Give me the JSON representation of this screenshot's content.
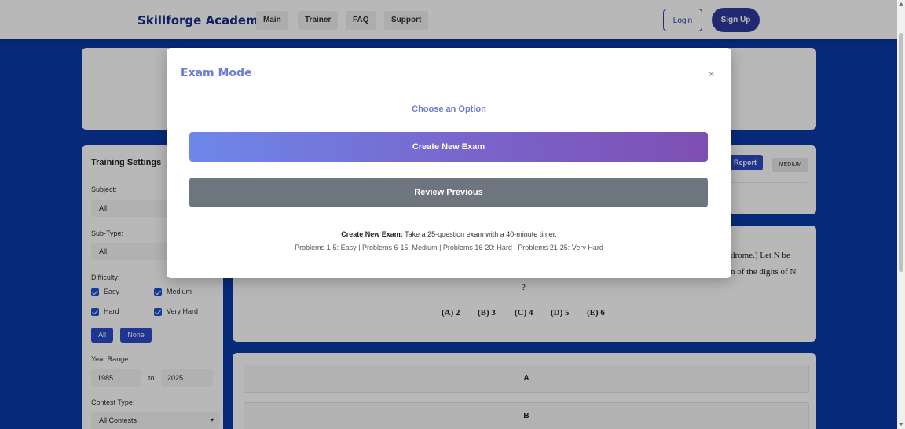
{
  "navbar": {
    "brand": "Skillforge Academy",
    "links": [
      "Main",
      "Trainer",
      "FAQ",
      "Support"
    ],
    "login_label": "Login",
    "signup_label": "Sign Up"
  },
  "sidebar": {
    "title": "Training Settings",
    "subject_label": "Subject:",
    "subject_value": "All",
    "subtype_label": "Sub-Type:",
    "subtype_value": "All",
    "difficulty_label": "Difficulty:",
    "difficulties": [
      "Easy",
      "Medium",
      "Hard",
      "Very Hard"
    ],
    "all_label": "All",
    "none_label": "None",
    "year_range_label": "Year Range:",
    "year_from": "1985",
    "year_to_label": "to",
    "year_to": "2025",
    "contest_type_label": "Contest Type:",
    "contest_type_value": "All Contests"
  },
  "problem": {
    "report_label": "Report",
    "difficulty_badge": "MEDIUM",
    "text_fragment_1": "drome.) Let N be",
    "text_fragment_2": "n of the digits of N",
    "text_fragment_3": "?",
    "choices": [
      "(A) 2",
      "(B) 3",
      "(C) 4",
      "(D) 5",
      "(E) 6"
    ]
  },
  "answers": [
    "A",
    "B"
  ],
  "modal": {
    "title": "Exam Mode",
    "close_symbol": "×",
    "subtitle": "Choose an Option",
    "create_label": "Create New Exam",
    "review_label": "Review Previous",
    "desc_bold": "Create New Exam:",
    "desc_text": " Take a 25-question exam with a 40-minute timer.",
    "desc_line2": "Problems 1-5: Easy | Problems 6-15: Medium | Problems 16-20: Hard | Problems 21-25: Very Hard"
  },
  "colors": {
    "page_background": "#0a3aa8",
    "modal_accent": "#6b7ad6",
    "review_button": "#6d757e"
  }
}
